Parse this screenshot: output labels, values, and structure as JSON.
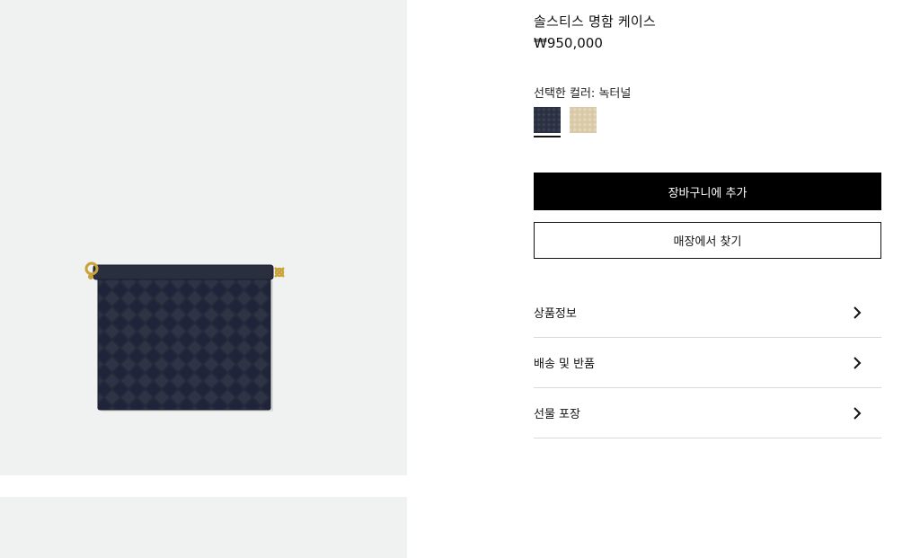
{
  "product": {
    "title": "솔스티스 명함 케이스",
    "price": "₩950,000"
  },
  "color_selector": {
    "label": "선택한 컬러: 녹터널",
    "swatches": [
      {
        "name": "녹터널",
        "color": "#2c3142",
        "selected": true
      },
      {
        "name": "beige",
        "color": "#d8c9a8",
        "selected": false
      }
    ]
  },
  "actions": {
    "add_to_bag": "장바구니에 추가",
    "find_in_store": "매장에서 찾기"
  },
  "accordion": [
    {
      "label": "상품정보",
      "icon": "chevron-right-icon"
    },
    {
      "label": "배송 및 반품",
      "icon": "chevron-right-icon"
    },
    {
      "label": "선물 포장",
      "icon": "chevron-right-icon"
    }
  ],
  "colors": {
    "gallery_bg": "#f0f2f1",
    "wallet": "#252a3a",
    "gold": "#c9a238",
    "primary_button": "#000000"
  }
}
